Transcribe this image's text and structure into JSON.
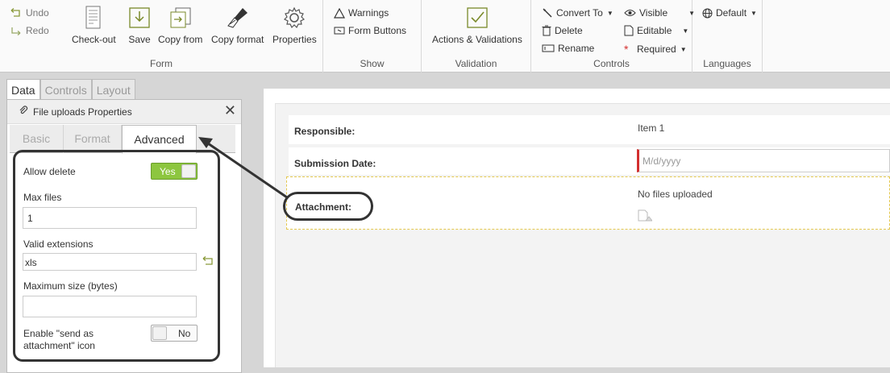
{
  "ribbon": {
    "form": {
      "undo": "Undo",
      "redo": "Redo",
      "checkout": "Check-out",
      "save": "Save",
      "copy_from": "Copy from",
      "copy_format": "Copy format",
      "properties": "Properties",
      "label": "Form"
    },
    "show": {
      "warnings": "Warnings",
      "form_buttons": "Form Buttons",
      "label": "Show"
    },
    "validation": {
      "actions": "Actions & Validations",
      "label": "Validation"
    },
    "controls": {
      "convert_to": "Convert To",
      "delete": "Delete",
      "rename": "Rename",
      "visible": "Visible",
      "editable": "Editable",
      "required": "Required",
      "label": "Controls"
    },
    "languages": {
      "default": "Default",
      "label": "Languages"
    }
  },
  "left_panel": {
    "tabs": [
      "Data",
      "Controls",
      "Layout"
    ],
    "active_tab": "Data",
    "title": "File uploads Properties",
    "subtabs": [
      "Basic",
      "Format",
      "Advanced"
    ],
    "active_subtab": "Advanced",
    "allow_delete": {
      "label": "Allow delete",
      "value": "Yes"
    },
    "max_files": {
      "label": "Max files",
      "value": "1"
    },
    "valid_extensions": {
      "label": "Valid extensions",
      "value": "xls"
    },
    "max_size": {
      "label": "Maximum size (bytes)",
      "value": ""
    },
    "send_attachment": {
      "label_line1": "Enable \"send as",
      "label_line2": "attachment\" icon",
      "value": "No"
    }
  },
  "form": {
    "responsible": {
      "label": "Responsible:",
      "value": "Item 1"
    },
    "submission_date": {
      "label": "Submission Date:",
      "placeholder": "M/d/yyyy"
    },
    "attachment": {
      "label": "Attachment:",
      "value": "No files uploaded"
    }
  },
  "colors": {
    "toggle_on": "#8dc63f",
    "required_marker": "#d32f2f",
    "selection_border": "#e4c850"
  }
}
